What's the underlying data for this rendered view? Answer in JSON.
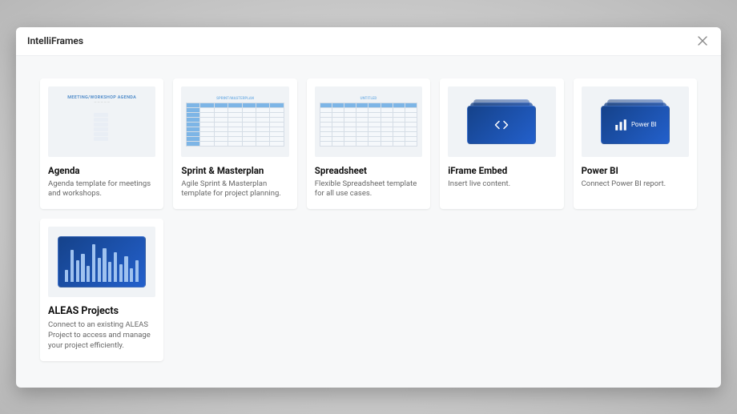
{
  "modal": {
    "title": "IntelliFrames"
  },
  "cards": {
    "agenda": {
      "title": "Agenda",
      "desc": "Agenda template for meetings and workshops.",
      "thumb_title": "MEETING/WORKSHOP AGENDA"
    },
    "sprint": {
      "title": "Sprint & Masterplan",
      "desc": "Agile Sprint & Masterplan template for project planning.",
      "thumb_title": "SPRINT/MASTERPLAN"
    },
    "spreadsheet": {
      "title": "Spreadsheet",
      "desc": "Flexible Spreadsheet template for all use cases.",
      "thumb_title": "UNTITLED"
    },
    "iframe": {
      "title": "iFrame Embed",
      "desc": "Insert live content."
    },
    "powerbi": {
      "title": "Power BI",
      "desc": "Connect Power BI report.",
      "thumb_label": "Power BI"
    },
    "aleas": {
      "title": "ALEAS Projects",
      "desc": "Connect to an existing ALEAS Project to access and manage your project efficiently."
    }
  }
}
